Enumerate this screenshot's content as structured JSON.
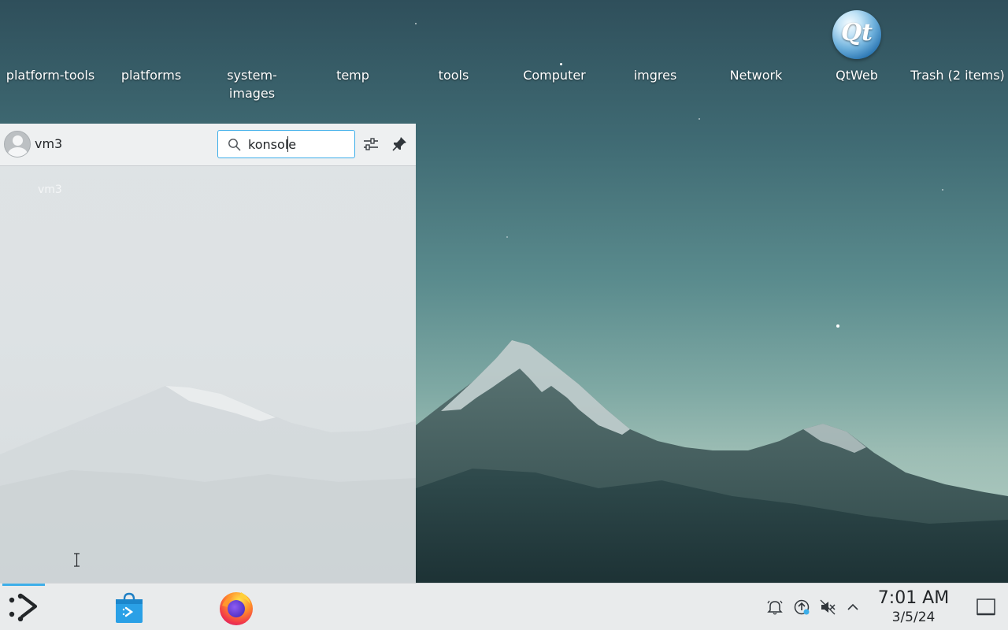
{
  "desktop": {
    "icons": [
      {
        "label": "platform-tools"
      },
      {
        "label": "platforms"
      },
      {
        "label": "system-\nimages"
      },
      {
        "label": "temp"
      },
      {
        "label": "tools"
      },
      {
        "label": "Computer"
      },
      {
        "label": "imgres"
      },
      {
        "label": "Network"
      },
      {
        "label": "QtWeb",
        "logo_text": "Qt"
      },
      {
        "label": "Trash (2 items)"
      }
    ]
  },
  "launcher": {
    "username": "vm3",
    "search": {
      "value": "konsole",
      "icon": "search-icon"
    },
    "configure_icon": "sliders-icon",
    "pin_icon": "pin-icon",
    "ghost_text": "vm3"
  },
  "taskbar": {
    "launcher_icon": "kde-app-launcher-icon",
    "apps": [
      {
        "name": "Discover",
        "icon": "discover-store-icon"
      },
      {
        "name": "Firefox",
        "icon": "firefox-icon"
      }
    ],
    "tray_icons": [
      "notifications-icon",
      "updates-icon",
      "volume-muted-icon",
      "chevron-up-icon"
    ],
    "clock": {
      "time": "7:01 AM",
      "date": "3/5/24"
    },
    "show_desktop_icon": "show-desktop-icon"
  },
  "colors": {
    "accent": "#3daee9",
    "panel": "#e9ebec",
    "text": "#232629"
  }
}
